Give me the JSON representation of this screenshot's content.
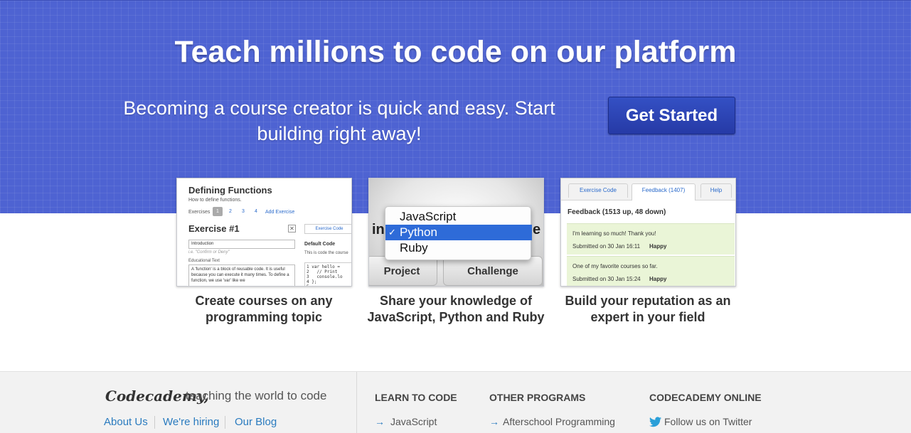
{
  "colors": {
    "hero_bg": "#4e63d2",
    "button_bg": "#263aa6",
    "link": "#2a7bbf",
    "feedback_bg": "#eaf5d7",
    "select_highlight": "#2e6bd8"
  },
  "hero": {
    "title": "Teach millions to code on our platform",
    "subtitle": "Becoming a course creator is quick and easy. Start building right away!",
    "cta_label": "Get Started"
  },
  "features": [
    {
      "caption": "Create courses on any programming topic",
      "preview": {
        "title": "Defining Functions",
        "subtitle": "How to define functions.",
        "exercises_label": "Exercises",
        "exercise_numbers": [
          "1",
          "2",
          "3",
          "4"
        ],
        "add_exercise": "Add Exercise",
        "exercise_title": "Exercise #1",
        "close_glyph": "✕",
        "title_value": "Introduction",
        "title_hint": "i.e. \"Confirm or Deny\"",
        "educational_text_label": "Educational Text",
        "educational_text": "A 'function' is a block of reusable code. It is useful because you can execute it many times. To define a function, we use 'var' like we",
        "code_tab": "Exercise Code",
        "default_code_label": "Default Code",
        "default_code_desc": "This is code the course",
        "code_lines": "1 var hello =\n2   // Print\n3   console.lo\n4 };\n5"
      }
    },
    {
      "caption": "Share your knowledge of JavaScript, Python and Ruby",
      "preview": {
        "background_left": "in",
        "background_right": "e",
        "options": [
          "JavaScript",
          "Python",
          "Ruby"
        ],
        "selected_option": "Python",
        "check_glyph": "✓",
        "buttons": [
          "Project",
          "Challenge"
        ]
      }
    },
    {
      "caption": "Build your reputation as an expert in your field",
      "preview": {
        "tabs": [
          "Exercise Code",
          "Feedback (1407)",
          "Help"
        ],
        "active_tab": "Feedback (1407)",
        "feedback_header": "Feedback (1513 up, 48 down)",
        "entries": [
          {
            "message": "I'm learning so much! Thank you!",
            "submitted": "Submitted on 30 Jan 16:11",
            "mood": "Happy"
          },
          {
            "message": "One of my favorite courses so far.",
            "submitted": "Submitted on 30 Jan 15:24",
            "mood": "Happy"
          }
        ]
      }
    }
  ],
  "footer": {
    "brand": "Codecademy,",
    "tagline": "teaching the world to code",
    "links": [
      "About Us",
      "We're hiring",
      "Our Blog"
    ],
    "arrow_glyph": "→",
    "columns": [
      {
        "heading": "LEARN TO CODE",
        "items": [
          "JavaScript"
        ]
      },
      {
        "heading": "OTHER PROGRAMS",
        "items": [
          "Afterschool Programming"
        ]
      },
      {
        "heading": "CODECADEMY ONLINE",
        "items": [
          "Follow us on Twitter"
        ],
        "icon": "twitter-bird-icon"
      }
    ]
  }
}
